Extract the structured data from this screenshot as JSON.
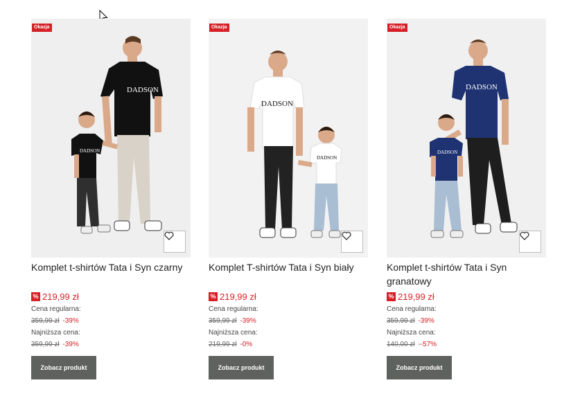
{
  "products": [
    {
      "badge": "Okazja",
      "title": "Komplet t-shirtów Tata i Syn czarny",
      "shirt_text": "DADSON",
      "shirt_color": "#111111",
      "price": "219,99 zł",
      "percent_symbol": "%",
      "regular_label": "Cena regularna:",
      "regular_old": "359,99 zł",
      "regular_discount": "-39%",
      "lowest_label": "Najniższa cena:",
      "lowest_old": "359,99 zł",
      "lowest_discount": "-39%",
      "button": "Zobacz produkt"
    },
    {
      "badge": "Okazja",
      "title": "Komplet T-shirtów Tata i Syn biały",
      "shirt_text": "DADSON",
      "shirt_color": "#ffffff",
      "price": "219,99 zł",
      "percent_symbol": "%",
      "regular_label": "Cena regularna:",
      "regular_old": "359,99 zł",
      "regular_discount": "-39%",
      "lowest_label": "Najniższa cena:",
      "lowest_old": "219,99 zł",
      "lowest_discount": "-0%",
      "button": "Zobacz produkt"
    },
    {
      "badge": "Okazja",
      "title": "Komplet t-shirtów Tata i Syn granatowy",
      "shirt_text": "DADSON",
      "shirt_color": "#1f3373",
      "price": "219,99 zł",
      "percent_symbol": "%",
      "regular_label": "Cena regularna:",
      "regular_old": "359,99 zł",
      "regular_discount": "-39%",
      "lowest_label": "Najniższa cena:",
      "lowest_old": "140,00 zł",
      "lowest_discount": "--57%",
      "button": "Zobacz produkt"
    }
  ],
  "colors": {
    "sale_red": "#d61f26",
    "button_gray": "#5e625e"
  },
  "icons": {
    "wishlist": "heart-icon",
    "cursor": "mouse-cursor-icon"
  }
}
